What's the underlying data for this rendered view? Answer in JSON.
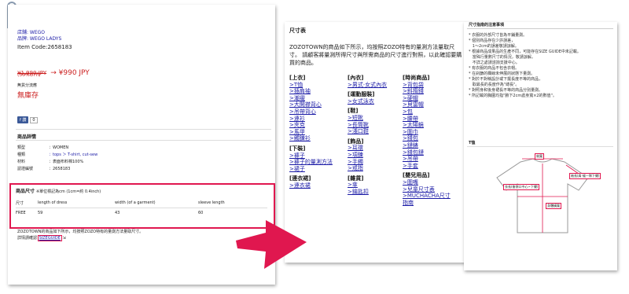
{
  "left": {
    "store_label": "店舗: WEGO",
    "brand_label": "品牌: WEGO LADYS",
    "item_code": "Item Code:2658183",
    "old_price": "¥1,990 JPY",
    "new_price": "→ ¥990 JPY",
    "discount": "(50%OFF)",
    "stock_label": "無貨分流應",
    "stock_status": "無庫存",
    "like_label": "讚",
    "like_count": "0",
    "details_title": "商品詳情",
    "details": [
      {
        "key": "類型",
        "value": "：WOMEN"
      },
      {
        "key": "種類",
        "value": "：tops ＞ T-shirt, cut-sew"
      },
      {
        "key": "材料",
        "value": "：表面布料棉100%"
      },
      {
        "key": "認證編號",
        "value": "：2658183"
      }
    ],
    "size_title": "商品尺寸",
    "size_note": "※單位標記為cm (1cm=約 0.4inch)",
    "size_headers": [
      "尺寸",
      "length of dress",
      "width (of a garment)",
      "sleeve length"
    ],
    "size_rows": [
      [
        "FREE",
        "59",
        "43",
        "60"
      ]
    ],
    "footnote": "ZOZOTOWN的商品如下所示，均按照ZOZO特有的量測方法量取尺寸。",
    "guide_prefix": "詳情請確認",
    "guide_link": "SIZEGUIDE"
  },
  "mid": {
    "title": "尺寸表",
    "intro": "ZOZOTOWN的商品如下所示，均按照ZOZO特有的量測方法量取尺寸。 請顧客將量測所得尺寸與所需商品的尺寸進行對照，以此確認要購買的商品。",
    "col1": [
      {
        "type": "h",
        "text": "[上衣]"
      },
      {
        "type": "i",
        "text": ">T恤"
      },
      {
        "type": "i",
        "text": ">插肩袖"
      },
      {
        "type": "i",
        "text": ">潮襯"
      },
      {
        "type": "i",
        "text": ">大開襟背心"
      },
      {
        "type": "i",
        "text": ">吊帶背心"
      },
      {
        "type": "i",
        "text": ">連衫"
      },
      {
        "type": "i",
        "text": ">夾克"
      },
      {
        "type": "i",
        "text": ">馬甲"
      },
      {
        "type": "i",
        "text": ">觸鍊衫"
      },
      {
        "type": "s",
        "text": ""
      },
      {
        "type": "h",
        "text": "[下裝]"
      },
      {
        "type": "i",
        "text": ">褲子"
      },
      {
        "type": "i",
        "text": ">褲子的量測方法"
      },
      {
        "type": "i",
        "text": ">裙子"
      },
      {
        "type": "s",
        "text": ""
      },
      {
        "type": "h",
        "text": "[連衣裙]"
      },
      {
        "type": "i",
        "text": ">連衣裙"
      }
    ],
    "col2": [
      {
        "type": "h",
        "text": "[內衣]"
      },
      {
        "type": "i",
        "text": ">男式·女式內衣"
      },
      {
        "type": "s",
        "text": ""
      },
      {
        "type": "h",
        "text": "[運動服裝]"
      },
      {
        "type": "i",
        "text": ">女式泳衣"
      },
      {
        "type": "s",
        "text": ""
      },
      {
        "type": "h",
        "text": "[鞋]"
      },
      {
        "type": "i",
        "text": ">短靴"
      },
      {
        "type": "i",
        "text": ">長筒靴"
      },
      {
        "type": "i",
        "text": ">淺口鞋"
      },
      {
        "type": "s",
        "text": ""
      },
      {
        "type": "h",
        "text": "[飾品]"
      },
      {
        "type": "i",
        "text": ">耳環"
      },
      {
        "type": "i",
        "text": ">項鍊"
      },
      {
        "type": "i",
        "text": ">手鐲"
      },
      {
        "type": "i",
        "text": ">戒指"
      },
      {
        "type": "s",
        "text": ""
      },
      {
        "type": "h",
        "text": "[雜貨]"
      },
      {
        "type": "i",
        "text": ">傘"
      },
      {
        "type": "i",
        "text": ">鑰匙扣"
      }
    ],
    "col3": [
      {
        "type": "h",
        "text": "[時尚商品]"
      },
      {
        "type": "i",
        "text": ">背包袋"
      },
      {
        "type": "i",
        "text": ">斜揹錢"
      },
      {
        "type": "i",
        "text": ">硬帽"
      },
      {
        "type": "i",
        "text": ">貝雷帽"
      },
      {
        "type": "i",
        "text": ">包"
      },
      {
        "type": "i",
        "text": ">腰帶"
      },
      {
        "type": "i",
        "text": ">太陽鏡"
      },
      {
        "type": "i",
        "text": ">圍巾"
      },
      {
        "type": "i",
        "text": ">錢包"
      },
      {
        "type": "i",
        "text": ">鏈錶"
      },
      {
        "type": "i",
        "text": ">錢包鏈"
      },
      {
        "type": "i",
        "text": ">吊帶"
      },
      {
        "type": "i",
        "text": ">手套"
      },
      {
        "type": "s",
        "text": ""
      },
      {
        "type": "h",
        "text": "[嬰兒用品]"
      },
      {
        "type": "i",
        "text": ">圍嘴"
      },
      {
        "type": "i",
        "text": ">兒童尺寸表"
      },
      {
        "type": "i",
        "text": ">MUCHACHA尺寸"
      },
      {
        "type": "i",
        "text": "指南"
      }
    ]
  },
  "right": {
    "title": "尺寸指南的注意事項",
    "notes": [
      "* 衣服的外部尺寸皆為平鋪量測。",
      "* 個別商品存在少許誤差，",
      "   1〜2cm的誤差敬請諒解。",
      "* 根據商品成果品的生產不同，可能存在SIZE GUIDE中未記載。",
      "   當殊行量數尺寸的情況，敬請諒解。",
      "   不詳之處請諮詢支援中心。",
      "* 有衣服的商品不包含衣帽。",
      "* 在刹篩的欄線未伸展的狀態下量測。",
      "* 對於不對稱設計或下擺長度不等的商品，",
      "   取最長的長度作為\"總長\"。",
      "* 對照身和後身裙長不等的商品分別量測。",
      "* 所記載的胸圍均指\"腋下2cm處身寬×2的數值\"。"
    ],
    "tshirt_title": "T恤",
    "diagram_labels": {
      "shoulder": "肩寬",
      "sleeve": "袖長(肩·縫一隊下擺)",
      "length": "衣長(後領口中心~下擺)",
      "width": "身體橫寬"
    }
  }
}
